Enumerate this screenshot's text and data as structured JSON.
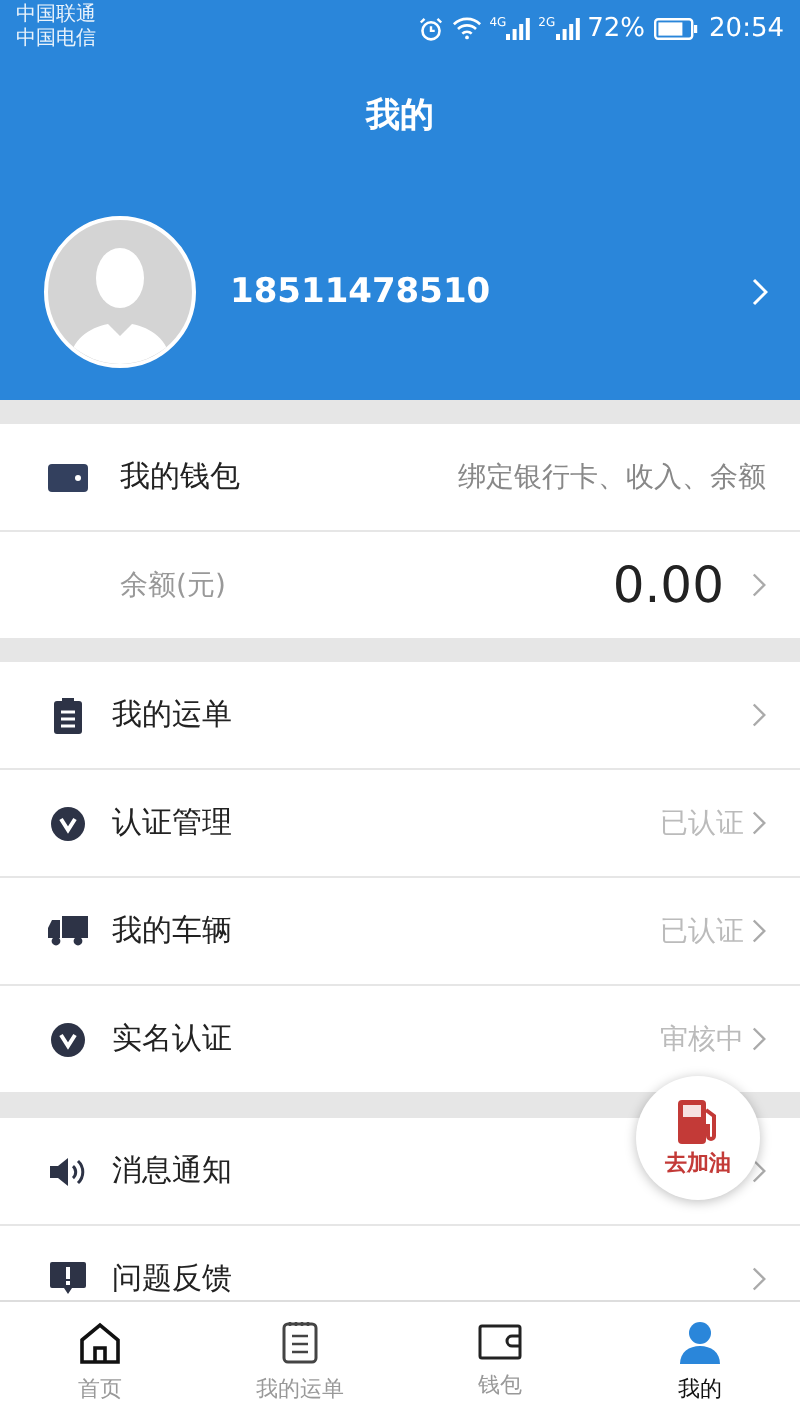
{
  "status_bar": {
    "carriers": [
      "中国联通",
      "中国电信"
    ],
    "signals": [
      {
        "kind": "alarm"
      },
      {
        "kind": "wifi"
      },
      {
        "kind": "signal",
        "label": "4G"
      },
      {
        "kind": "signal",
        "label": "2G"
      }
    ],
    "battery": "72%",
    "time": "20:54"
  },
  "header": {
    "title": "我的"
  },
  "profile": {
    "phone": "18511478510"
  },
  "wallet": {
    "title": "我的钱包",
    "hint": "绑定银行卡、收入、余额",
    "balance_label": "余额(元)",
    "balance": "0.00"
  },
  "menu_groups": [
    [
      {
        "kind": "clipboard",
        "label": "我的运单"
      },
      {
        "kind": "badge",
        "label": "认证管理",
        "status": "已认证"
      },
      {
        "kind": "truck",
        "label": "我的车辆",
        "status": "已认证"
      },
      {
        "kind": "badge",
        "label": "实名认证",
        "status": "审核中"
      }
    ],
    [
      {
        "kind": "speaker",
        "label": "消息通知"
      },
      {
        "kind": "alert",
        "label": "问题反馈"
      }
    ]
  ],
  "fuel_button": {
    "label": "去加油"
  },
  "tabs": [
    {
      "kind": "home",
      "label": "首页",
      "selected": false
    },
    {
      "kind": "list",
      "label": "我的运单",
      "selected": false
    },
    {
      "kind": "wallet",
      "label": "钱包",
      "selected": false
    },
    {
      "kind": "person",
      "label": "我的",
      "selected": true
    }
  ]
}
